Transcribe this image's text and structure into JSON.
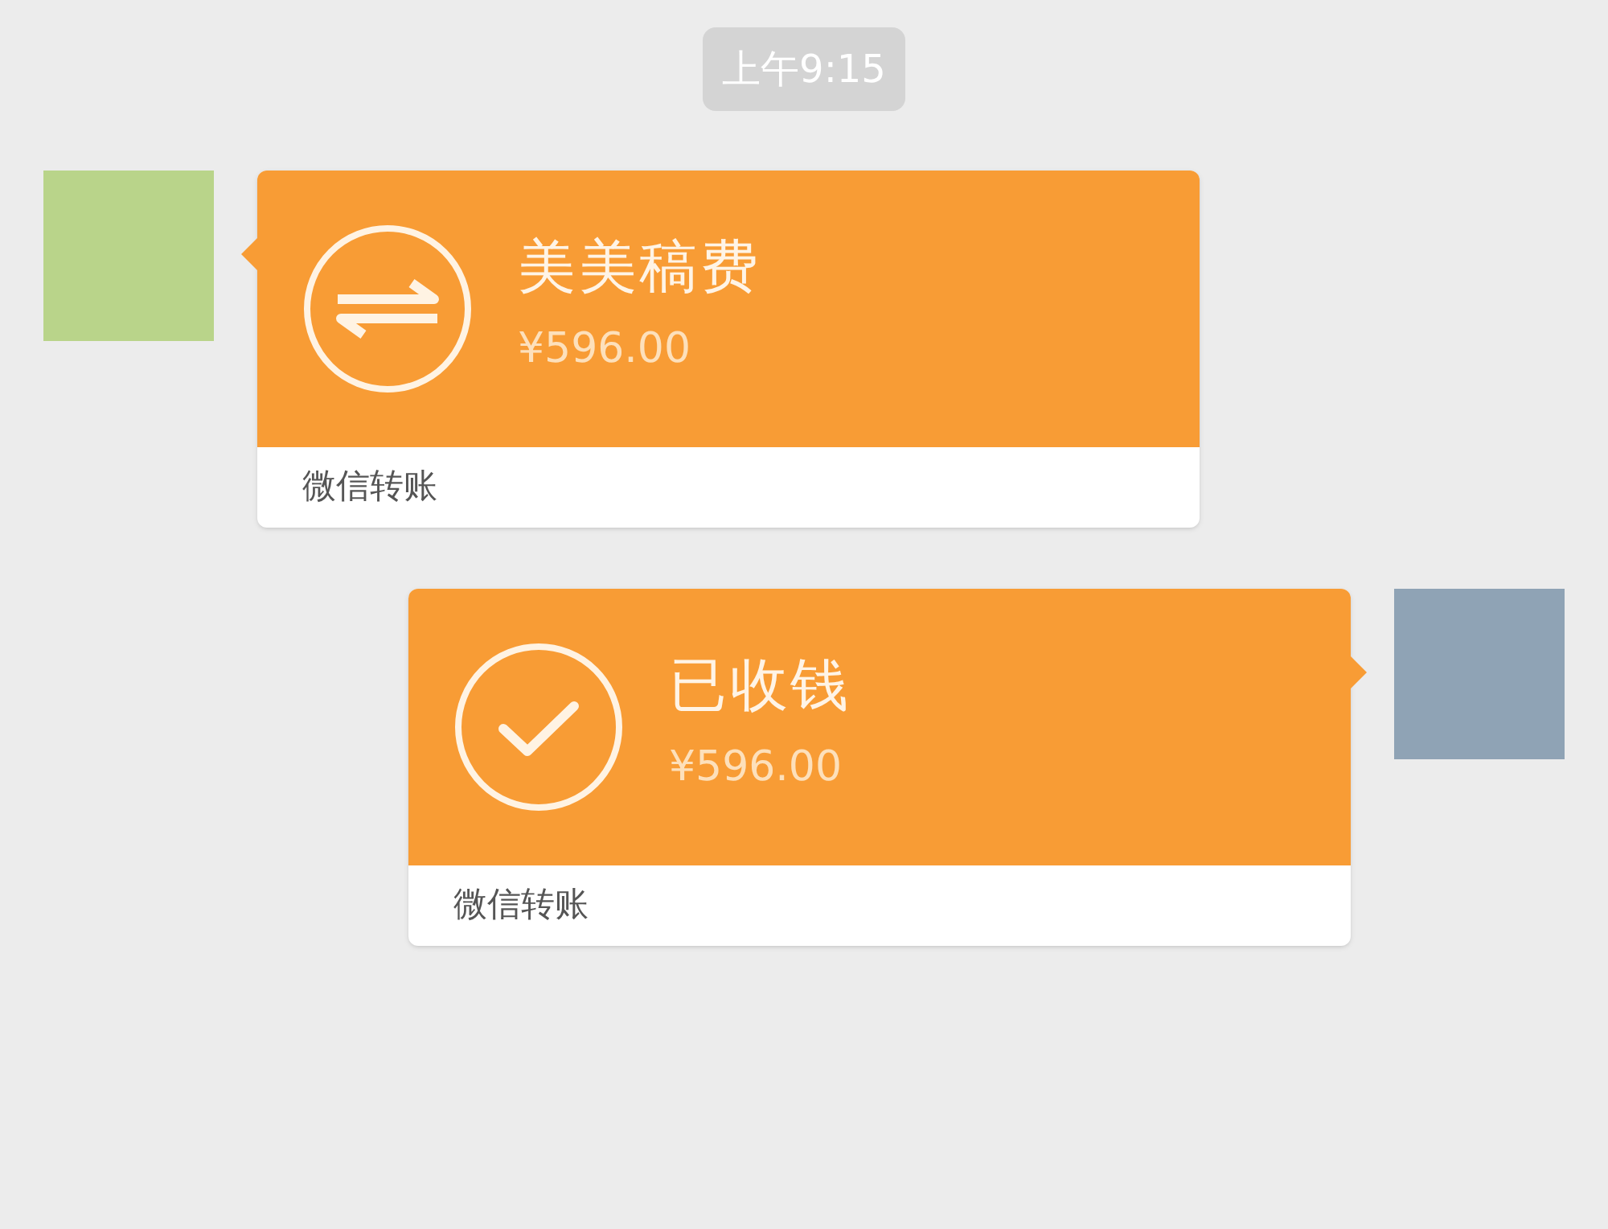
{
  "timestamp": "上午9:15",
  "messages": [
    {
      "kind": "incoming",
      "title": "美美稿费",
      "amount": "¥596.00",
      "footer": "微信转账"
    },
    {
      "kind": "outgoing",
      "title": "已收钱",
      "amount": "¥596.00",
      "footer": "微信转账"
    }
  ]
}
